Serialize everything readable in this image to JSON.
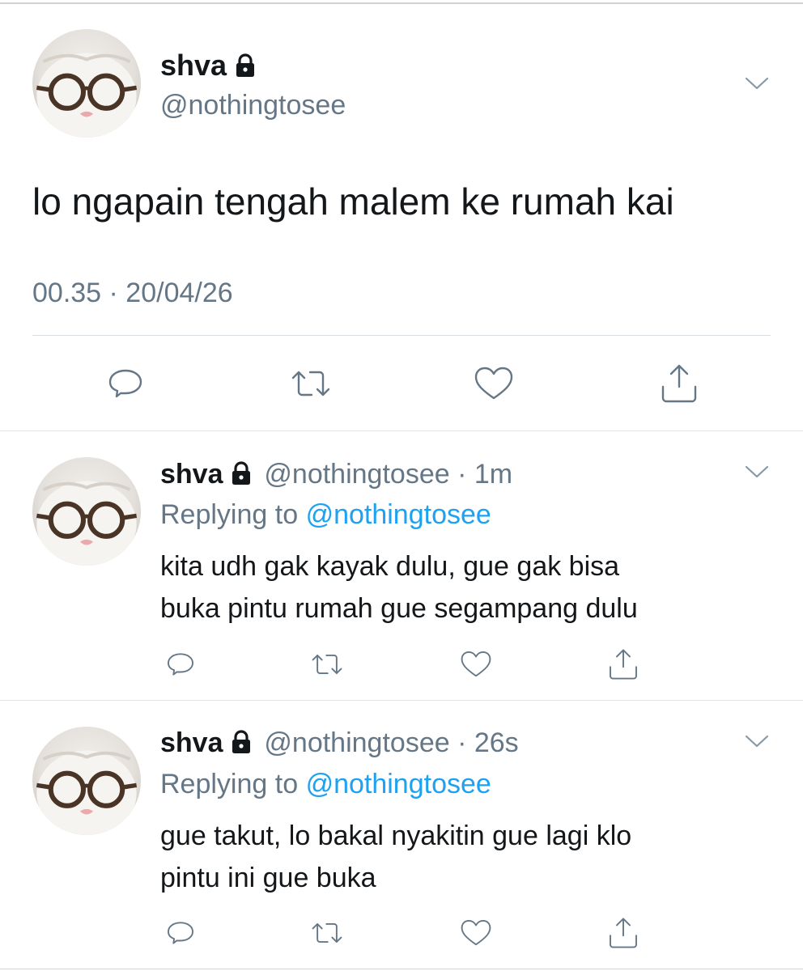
{
  "main_tweet": {
    "display_name": "shva",
    "handle": "@nothingtosee",
    "text": "lo ngapain tengah malem ke rumah kai",
    "timestamp": "00.35 · 20/04/26"
  },
  "replies": [
    {
      "display_name": "shva",
      "handle": "@nothingtosee",
      "time": "· 1m",
      "replying_prefix": "Replying to",
      "replying_to": "@nothingtosee",
      "line1": "kita udh gak kayak dulu, gue gak bisa",
      "line2": "buka pintu rumah gue segampang dulu"
    },
    {
      "display_name": "shva",
      "handle": "@nothingtosee",
      "time": "· 26s",
      "replying_prefix": "Replying to",
      "replying_to": "@nothingtosee",
      "line1": "gue takut, lo bakal nyakitin gue lagi klo",
      "line2": "pintu ini gue buka"
    }
  ],
  "icons": [
    "reply-icon",
    "retweet-icon",
    "like-icon",
    "share-icon",
    "lock-icon",
    "chevron-down-icon"
  ],
  "colors": {
    "link": "#1da1f2",
    "secondary": "#657786",
    "text": "#14171a"
  }
}
